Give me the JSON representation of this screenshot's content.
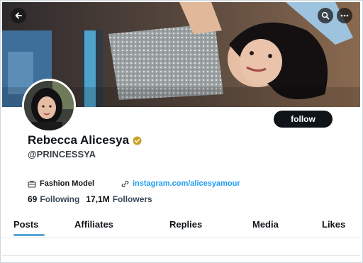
{
  "profile": {
    "display_name": "Rebecca Alicesya",
    "handle": "@PRINCESSYA",
    "occupation": "Fashion Model",
    "link": "instagram.com/alicesyamour",
    "follow_label": "follow"
  },
  "stats": {
    "following_count": "69",
    "following_label": "Following",
    "followers_count": "17,1M",
    "followers_label": "Followers"
  },
  "tabs": [
    {
      "label": "Posts",
      "active": true
    },
    {
      "label": "Affiliates",
      "active": false
    },
    {
      "label": "Replies",
      "active": false
    },
    {
      "label": "Media",
      "active": false
    },
    {
      "label": "Likes",
      "active": false
    }
  ],
  "icons": {
    "back": "arrow-left-icon",
    "search": "search-icon",
    "more": "more-icon",
    "verified": "verified-badge-icon",
    "occupation": "briefcase-icon",
    "link": "link-icon"
  },
  "colors": {
    "accent": "#1d9bf0",
    "verified": "#c9a227",
    "follow_button": "#0f1419",
    "tab_indicator": "#5aa6d6"
  }
}
